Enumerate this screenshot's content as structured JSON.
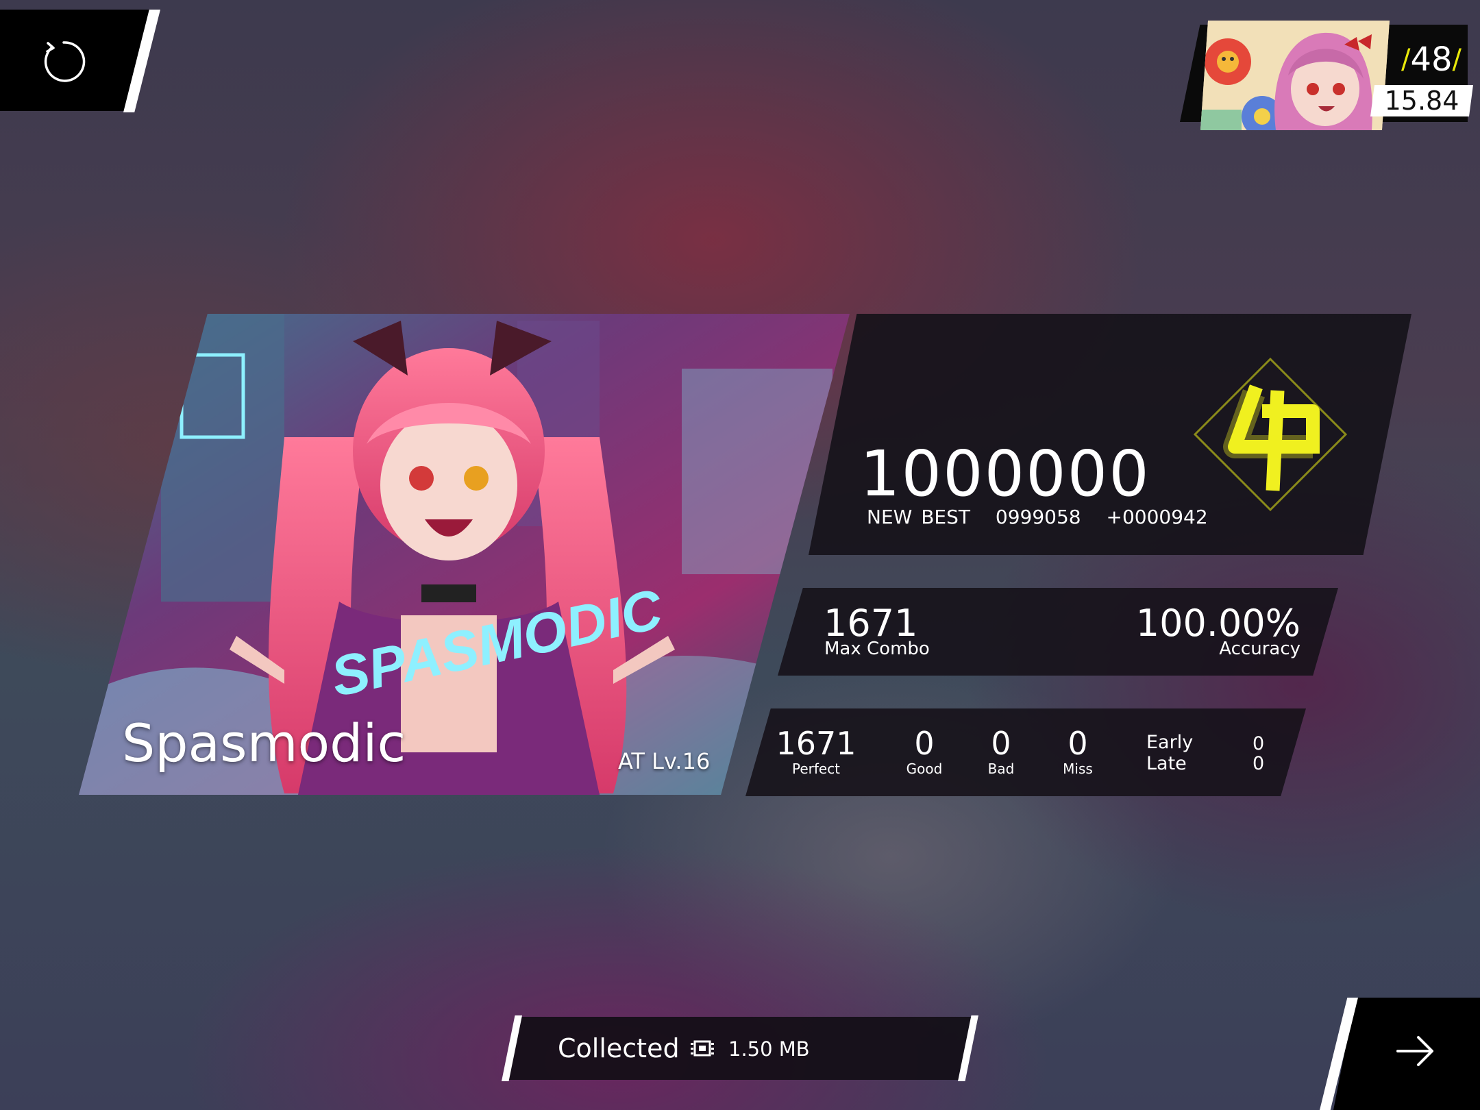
{
  "player": {
    "rank": "48",
    "rks": "15.84"
  },
  "song": {
    "name": "Spasmodic",
    "difficulty": "AT Lv.16",
    "art_text": "SPASMODIC"
  },
  "score": {
    "value": "1000000",
    "new_best_label": "NEW BEST",
    "previous_best": "0999058",
    "delta": "+0000942",
    "grade": "φ"
  },
  "stats": {
    "max_combo": "1671",
    "max_combo_label": "Max Combo",
    "accuracy": "100.00%",
    "accuracy_label": "Accuracy"
  },
  "judgements": {
    "perfect": "1671",
    "perfect_label": "Perfect",
    "good": "0",
    "good_label": "Good",
    "bad": "0",
    "bad_label": "Bad",
    "miss": "0",
    "miss_label": "Miss",
    "early_label": "Early",
    "early": "0",
    "late_label": "Late",
    "late": "0"
  },
  "collection": {
    "label": "Collected",
    "size": "1.50 MB"
  },
  "icons": [
    "retry-icon",
    "next-arrow-icon",
    "memory-chip-icon"
  ],
  "colors": {
    "grade_yellow": "#f0f020",
    "panel_dark": "#16121a",
    "rank_slash": "#e8e80a"
  }
}
